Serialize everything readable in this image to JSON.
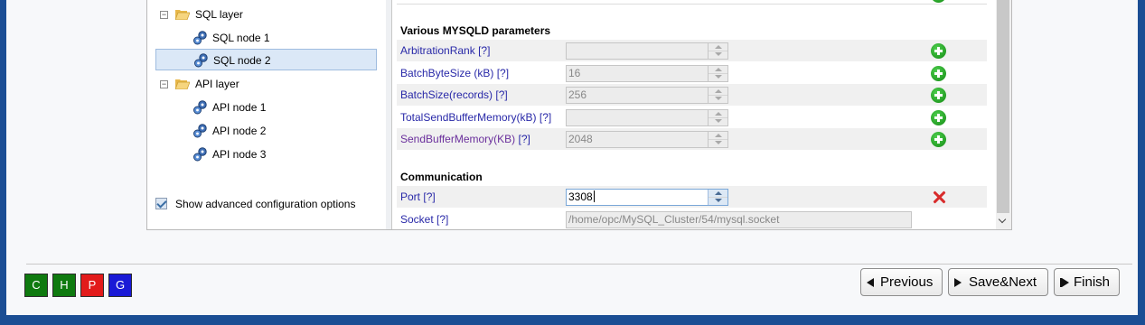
{
  "tree": {
    "items": [
      {
        "label": "SQL layer"
      },
      {
        "label": "SQL node 1"
      },
      {
        "label": "SQL node 2"
      },
      {
        "label": "API layer"
      },
      {
        "label": "API node 1"
      },
      {
        "label": "API node 2"
      },
      {
        "label": "API node 3"
      }
    ],
    "advanced_label": "Show advanced configuration options"
  },
  "sections": {
    "mysqld_title": "Various MYSQLD parameters",
    "comm_title": "Communication"
  },
  "params": [
    {
      "name": "ArbitrationRank",
      "help": "[?]",
      "value": ""
    },
    {
      "name": "BatchByteSize (kB)",
      "help": "[?]",
      "value": "16"
    },
    {
      "name": "BatchSize(records)",
      "help": "[?]",
      "value": "256"
    },
    {
      "name": "TotalSendBufferMemory(kB)",
      "help": "[?]",
      "value": ""
    },
    {
      "name": "SendBufferMemory(KB)",
      "help": "[?]",
      "value": "2048"
    }
  ],
  "comm": [
    {
      "name": "Port",
      "help": "[?]",
      "value": "3308"
    },
    {
      "name": "Socket",
      "help": "[?]",
      "value": "/home/opc/MySQL_Cluster/54/mysql.socket"
    }
  ],
  "legend": [
    {
      "label": "C",
      "color": "#0f7a0f"
    },
    {
      "label": "H",
      "color": "#0f7a0f"
    },
    {
      "label": "P",
      "color": "#e21b1b"
    },
    {
      "label": "G",
      "color": "#1a1ad6"
    }
  ],
  "nav": {
    "previous": "Previous",
    "save_next": "Save&Next",
    "finish": "Finish"
  },
  "colors": {
    "accent": "#1b4e94",
    "param_link": "#2828a8",
    "add": "#1e9a1e",
    "delete": "#d82b2b"
  }
}
